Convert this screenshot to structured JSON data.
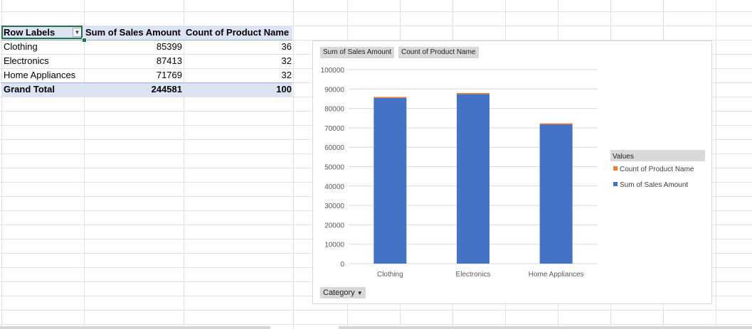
{
  "pivot_table": {
    "headers": [
      "Row Labels",
      "Sum of Sales Amount",
      "Count of Product Name"
    ],
    "rows": [
      {
        "label": "Clothing",
        "sales": "85399",
        "count": "36"
      },
      {
        "label": "Electronics",
        "sales": "87413",
        "count": "32"
      },
      {
        "label": "Home Appliances",
        "sales": "71769",
        "count": "32"
      }
    ],
    "grand_total": {
      "label": "Grand Total",
      "sales": "244581",
      "count": "100"
    }
  },
  "pivot_chart": {
    "field_buttons": [
      "Sum of Sales Amount",
      "Count of Product Name"
    ],
    "axis_field_button": "Category",
    "legend_title": "Values",
    "colors": {
      "sales": "#4472c4",
      "count": "#ed7d31",
      "field_button": "#d9d9d9",
      "grid": "#d9d9d9"
    }
  },
  "chart_data": {
    "type": "bar",
    "stacked": true,
    "categories": [
      "Clothing",
      "Electronics",
      "Home Appliances"
    ],
    "series": [
      {
        "name": "Sum of Sales Amount",
        "values": [
          85399,
          87413,
          71769
        ]
      },
      {
        "name": "Count of Product Name",
        "values": [
          36,
          32,
          32
        ]
      }
    ],
    "ylim": [
      0,
      100000
    ],
    "yticks": [
      "0",
      "10000",
      "20000",
      "30000",
      "40000",
      "50000",
      "60000",
      "70000",
      "80000",
      "90000",
      "100000"
    ],
    "grid": true,
    "legend": "right",
    "legend_entries": [
      "Count of Product Name",
      "Sum of Sales Amount"
    ]
  }
}
